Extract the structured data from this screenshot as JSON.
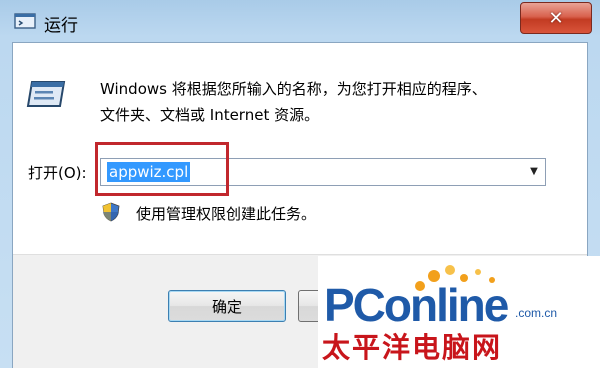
{
  "titlebar": {
    "title": "运行",
    "close_symbol": "✕"
  },
  "main": {
    "description_line1": "Windows 将根据您所输入的名称，为您打开相应的程序、",
    "description_line2": "文件夹、文档或 Internet 资源。",
    "open_label": "打开(O):",
    "open_value": "appwiz.cpl",
    "admin_note": "使用管理权限创建此任务。"
  },
  "buttons": {
    "ok_label": "确定",
    "cancel_label": ""
  },
  "watermark": {
    "brand": "PConline",
    "domain": ".com.cn",
    "chinese": "太平洋电脑网"
  },
  "icons": {
    "window": "run-icon",
    "large": "run-dialog-icon",
    "shield": "uac-shield-icon",
    "dropdown": "chevron-down-icon"
  },
  "colors": {
    "selection": "#3399ff",
    "highlight_border": "#c1272d",
    "close_button": "#c23b22",
    "watermark_blue": "#1f5aa8",
    "watermark_red": "#c8151b"
  }
}
